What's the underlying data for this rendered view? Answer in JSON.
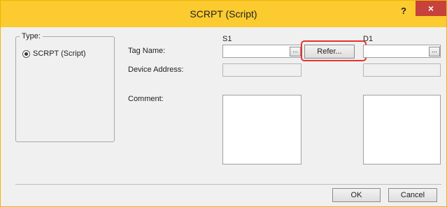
{
  "window": {
    "title": "SCRPT (Script)",
    "help_label": "?",
    "close_label": "×"
  },
  "type_group": {
    "legend": "Type:",
    "option_label": "SCRPT (Script)",
    "option_selected": true
  },
  "columns": {
    "s1": "S1",
    "d1": "D1"
  },
  "rows": {
    "tag_name": "Tag Name:",
    "device_address": "Device Address:",
    "comment": "Comment:"
  },
  "fields": {
    "s1_tag_value": "",
    "d1_tag_value": "",
    "s1_device_address": "",
    "d1_device_address": ""
  },
  "buttons": {
    "browse_label": "...",
    "refer_label": "Refer...",
    "ok_label": "OK",
    "cancel_label": "Cancel"
  },
  "colors": {
    "titlebar": "#fbcb2f",
    "close_button": "#c7423a",
    "highlight": "#e63230"
  },
  "icons": {
    "help": "help-icon",
    "close": "close-icon",
    "radio": "radio-selected-icon"
  }
}
